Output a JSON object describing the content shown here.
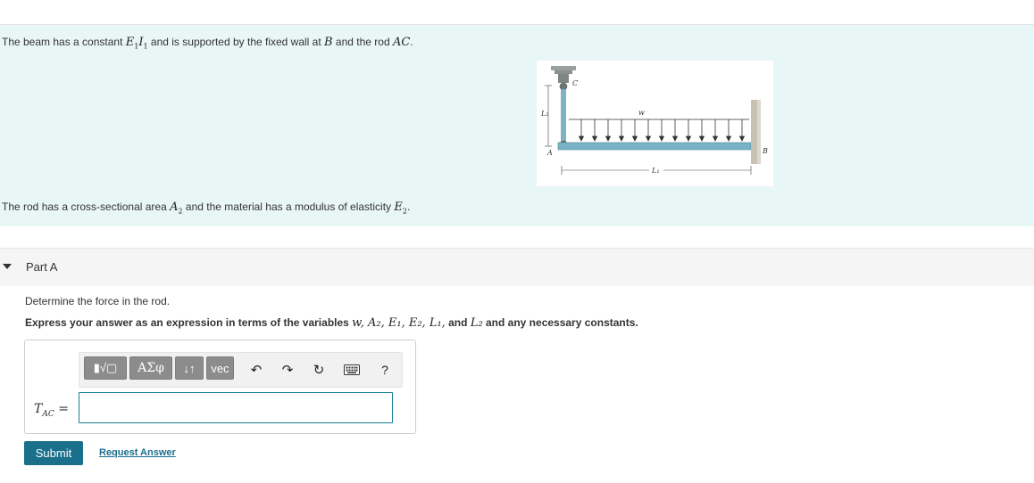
{
  "intro": {
    "line1_a": "The beam has a constant ",
    "line1_var1": "E",
    "line1_sub1": "1",
    "line1_var2": "I",
    "line1_sub2": "1",
    "line1_b": " and is supported by the fixed wall at ",
    "line1_var3": "B",
    "line1_c": " and the rod ",
    "line1_var4": "AC",
    "line1_d": ".",
    "line2_a": "The rod has a cross-sectional area ",
    "line2_var1": "A",
    "line2_sub1": "2",
    "line2_b": " and the material has a modulus of elasticity ",
    "line2_var2": "E",
    "line2_sub2": "2",
    "line2_c": "."
  },
  "figure": {
    "label_c": "C",
    "label_a": "A",
    "label_b": "B",
    "label_w": "w",
    "label_l1": "L₁",
    "label_l2": "L₂"
  },
  "part": {
    "title": "Part A"
  },
  "question": {
    "text": "Determine the force in the rod.",
    "instruction_a": "Express your answer as an expression in terms of the variables ",
    "instruction_vars": "w, A₂, E₁, E₂, L₁,",
    "instruction_and": " and ",
    "instruction_last": "L₂",
    "instruction_b": " and any necessary constants."
  },
  "toolbar": {
    "templates_label": "▮√▢",
    "greek_label": "ΑΣφ",
    "arrows_label": "↓↑",
    "vec_label": "vec",
    "undo_icon": "↶",
    "redo_icon": "↷",
    "reset_icon": "↻",
    "help_label": "?"
  },
  "answer": {
    "variable": "T",
    "variable_sub": "AC",
    "equals": "=",
    "value": ""
  },
  "actions": {
    "submit_label": "Submit",
    "request_label": "Request Answer"
  }
}
